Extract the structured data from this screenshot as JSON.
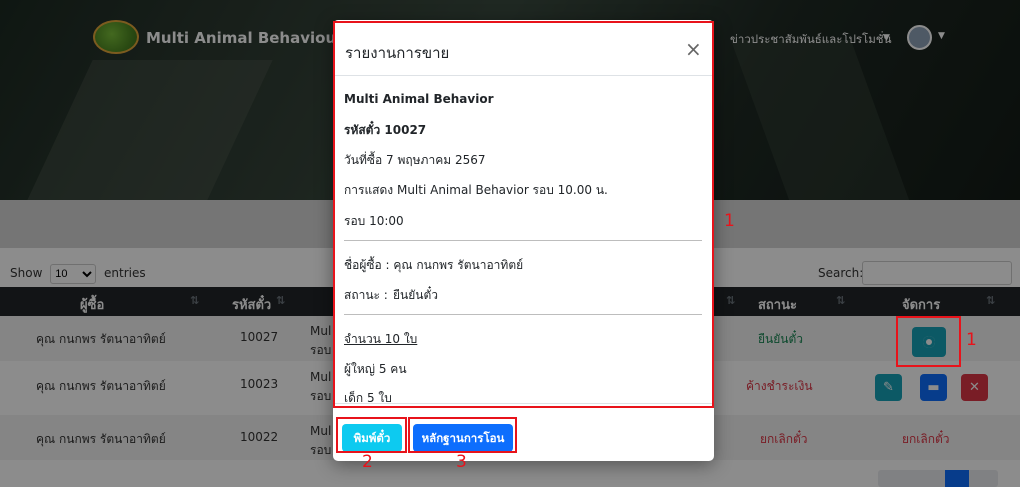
{
  "nav": {
    "brand": "Multi Animal Behaviour Chi",
    "news_link": "ข่าวประชาสัมพันธ์และโปรโมชั่น"
  },
  "table_controls": {
    "show_label": "Show",
    "show_value": "10",
    "entries_label": "entries",
    "search_label": "Search:"
  },
  "table": {
    "headers": [
      "ผู้ซื้อ",
      "รหัสตั๋ว",
      "สถานะ",
      "จัดการ"
    ],
    "rows": [
      {
        "buyer": "คุณ กนกพร รัตนาอาทิตย์",
        "ticket": "10027",
        "show1": "Mul",
        "show2": "รอบ",
        "status": "ยืนยันตั๋ว",
        "action": ""
      },
      {
        "buyer": "คุณ กนกพร รัตนาอาทิตย์",
        "ticket": "10023",
        "show1": "Mul",
        "show2": "รอบ",
        "status": "ค้างชำระเงิน",
        "action": ""
      },
      {
        "buyer": "คุณ กนกพร รัตนาอาทิตย์",
        "ticket": "10022",
        "show1": "Mul",
        "show2": "รอบ",
        "status": "ยกเลิกตั๋ว",
        "action": "ยกเลิกตั๋ว"
      }
    ]
  },
  "modal": {
    "title": "รายงานการขาย",
    "close": "×",
    "show_name": "Multi Animal Behavior",
    "ticket_code": "รหัสตั๋ว 10027",
    "purchase_date": "วันที่ซื้อ  7 พฤษภาคม 2567",
    "performance": "การแสดง  Multi Animal Behavior รอบ 10.00 น.",
    "round": "รอบ  10:00",
    "buyer_name": "ชื่อผู้ซื้อ  :  คุณ กนกพร  รัตนาอาทิตย์",
    "status_label": "สถานะ  :",
    "status_value": "ยืนยันตั๋ว",
    "quantity": "จำนวน  10  ใบ",
    "adults": "ผู้ใหญ่  5  คน",
    "children": "เด็ก  5  ใบ",
    "print_button": "พิมพ์ตั๋ว",
    "proof_button": "หลักฐานการโอน"
  },
  "annotations": [
    "1",
    "1",
    "2",
    "3"
  ],
  "colors": {
    "accent": "#0d6efd",
    "info": "#0dcaf0",
    "success": "#198754",
    "danger": "#dc3545",
    "annotation": "#e8131b"
  }
}
